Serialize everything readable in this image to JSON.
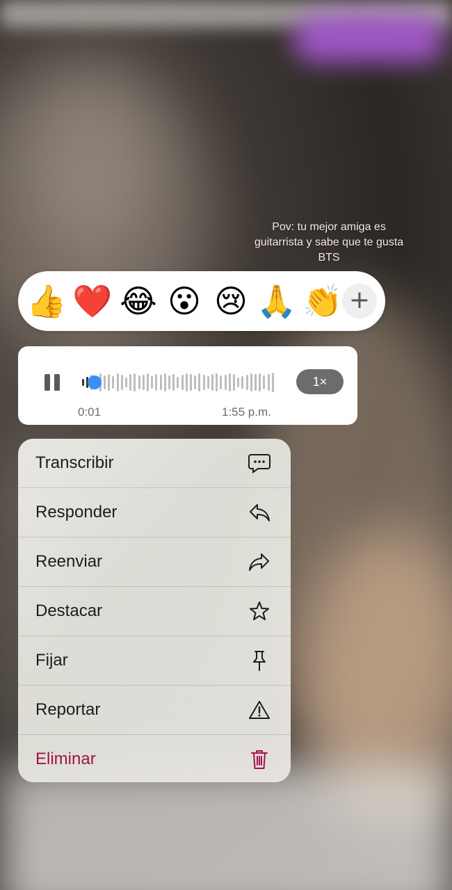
{
  "caption": "Pov: tu mejor amiga es guitarrista y sabe que te gusta BTS",
  "reactions": {
    "emojis": [
      {
        "name": "thumbs-up",
        "char": "👍"
      },
      {
        "name": "red-heart",
        "char": "❤️"
      },
      {
        "name": "tears-of-joy",
        "char": "😂"
      },
      {
        "name": "surprised-face",
        "char": "😮"
      },
      {
        "name": "crying-face",
        "char": "😢"
      },
      {
        "name": "folded-hands",
        "char": "🙏"
      },
      {
        "name": "clapping-hands",
        "char": "👏"
      }
    ],
    "more": "+"
  },
  "voice_message": {
    "elapsed": "0:01",
    "timestamp": "1:55 p.m.",
    "speed": "1×",
    "progress": 0.04
  },
  "menu": {
    "items": [
      {
        "label": "Transcribir",
        "icon": "speech-bubble-icon"
      },
      {
        "label": "Responder",
        "icon": "reply-icon"
      },
      {
        "label": "Reenviar",
        "icon": "forward-icon"
      },
      {
        "label": "Destacar",
        "icon": "star-icon"
      },
      {
        "label": "Fijar",
        "icon": "pin-icon"
      },
      {
        "label": "Reportar",
        "icon": "warning-icon"
      },
      {
        "label": "Eliminar",
        "icon": "trash-icon"
      }
    ]
  },
  "colors": {
    "accent_blue": "#3b8ff3",
    "danger": "#a3124a"
  }
}
